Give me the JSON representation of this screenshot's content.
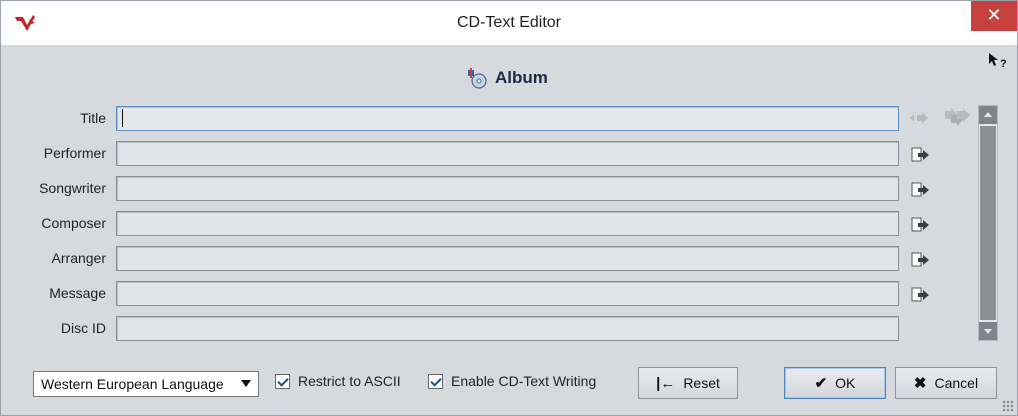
{
  "window": {
    "title": "CD-Text Editor",
    "close_glyph": "✕"
  },
  "header": {
    "title": "Album"
  },
  "fields": [
    {
      "label": "Title",
      "value": "",
      "has_copy": false
    },
    {
      "label": "Performer",
      "value": "",
      "has_copy": true
    },
    {
      "label": "Songwriter",
      "value": "",
      "has_copy": true
    },
    {
      "label": "Composer",
      "value": "",
      "has_copy": true
    },
    {
      "label": "Arranger",
      "value": "",
      "has_copy": true
    },
    {
      "label": "Message",
      "value": "",
      "has_copy": true
    },
    {
      "label": "Disc ID",
      "value": "",
      "has_copy": false
    }
  ],
  "footer": {
    "language_select": "Western European Language",
    "restrict_ascii": {
      "label": "Restrict to ASCII",
      "checked": true
    },
    "enable_cdtext": {
      "label": "Enable CD-Text Writing",
      "checked": true
    },
    "reset_label": "Reset",
    "reset_glyph": "|←",
    "ok_label": "OK",
    "ok_glyph": "✔",
    "cancel_label": "Cancel",
    "cancel_glyph": "✖"
  },
  "icons": {
    "app": "wavelab-logo-icon",
    "help": "context-help-icon",
    "album": "album-disc-icon",
    "row_copy": "copy-to-tracks-icon",
    "title_copy": "copy-arrow-icon",
    "title_copy_all": "copy-all-icon"
  },
  "colors": {
    "close": "#c7423e",
    "accent": "#4f84c4",
    "background": "#d6dadf"
  }
}
